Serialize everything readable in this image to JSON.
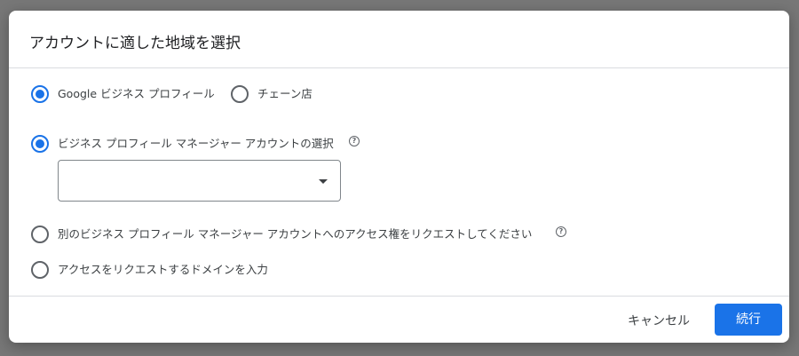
{
  "dialog": {
    "title": "アカウントに適した地域を選択"
  },
  "business_type": {
    "options": [
      {
        "label": "Google ビジネス プロフィール",
        "checked": true
      },
      {
        "label": "チェーン店",
        "checked": false
      }
    ]
  },
  "account_source": {
    "options": [
      {
        "label": "ビジネス プロフィール マネージャー アカウントの選択",
        "checked": true,
        "has_help": true
      },
      {
        "label": "別のビジネス プロフィール マネージャー アカウントへのアクセス権をリクエストしてください",
        "checked": false,
        "has_help": true
      },
      {
        "label": "アクセスをリクエストするドメインを入力",
        "checked": false,
        "has_help": false
      }
    ],
    "select_value": ""
  },
  "footer": {
    "cancel_label": "キャンセル",
    "continue_label": "続行"
  },
  "colors": {
    "accent": "#1a73e8",
    "text": "#3c4043",
    "divider": "#dadce0"
  },
  "icons": {
    "help": "help-circle-icon",
    "dropdown": "arrow-drop-down-icon"
  }
}
